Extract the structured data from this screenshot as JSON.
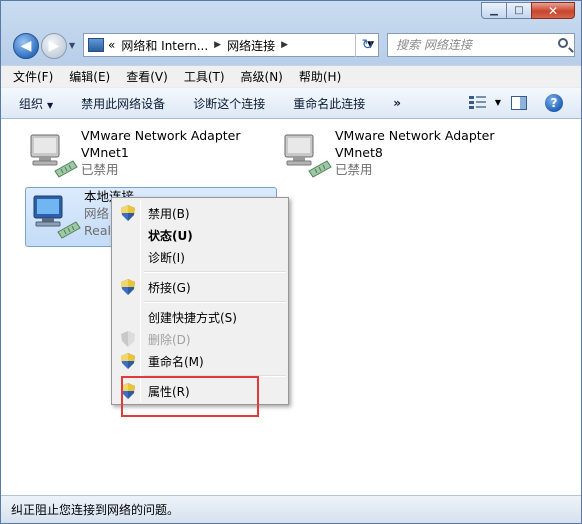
{
  "window": {
    "minimize": "▁",
    "maximize": "□",
    "close": "✕"
  },
  "nav": {
    "back": "◀",
    "forward": "▶",
    "breadcrumb_prefix": "«",
    "breadcrumb": [
      "网络和 Intern...",
      "网络连接"
    ],
    "refresh": "↻",
    "search_placeholder": "搜索 网络连接"
  },
  "menubar": [
    "文件(F)",
    "编辑(E)",
    "查看(V)",
    "工具(T)",
    "高级(N)",
    "帮助(H)"
  ],
  "cmdbar": {
    "organize": "组织",
    "items": [
      "禁用此网络设备",
      "诊断这个连接",
      "重命名此连接"
    ],
    "more": "»"
  },
  "adapters": [
    {
      "name": "VMware Network Adapter",
      "sub": "VMnet1",
      "status": "已禁用"
    },
    {
      "name": "VMware Network Adapter",
      "sub": "VMnet8",
      "status": "已禁用"
    },
    {
      "name": "本地连接",
      "sub": "网络",
      "status": "Realt"
    }
  ],
  "context_menu": [
    {
      "label": "禁用(B)",
      "shield": true,
      "disabled": false,
      "bold": false
    },
    {
      "label": "状态(U)",
      "shield": false,
      "disabled": false,
      "bold": true
    },
    {
      "label": "诊断(I)",
      "shield": false,
      "disabled": false,
      "bold": false
    },
    {
      "label": "桥接(G)",
      "shield": true,
      "disabled": false,
      "bold": false
    },
    {
      "label": "创建快捷方式(S)",
      "shield": false,
      "disabled": false,
      "bold": false
    },
    {
      "label": "删除(D)",
      "shield": true,
      "disabled": true,
      "bold": false
    },
    {
      "label": "重命名(M)",
      "shield": true,
      "disabled": false,
      "bold": false
    },
    {
      "label": "属性(R)",
      "shield": true,
      "disabled": false,
      "bold": false
    }
  ],
  "statusbar": "纠正阻止您连接到网络的问题。",
  "colors": {
    "highlight": "#e13a3a",
    "selection": "#c4dcf7",
    "disabled_text": "#a0a0a0"
  }
}
